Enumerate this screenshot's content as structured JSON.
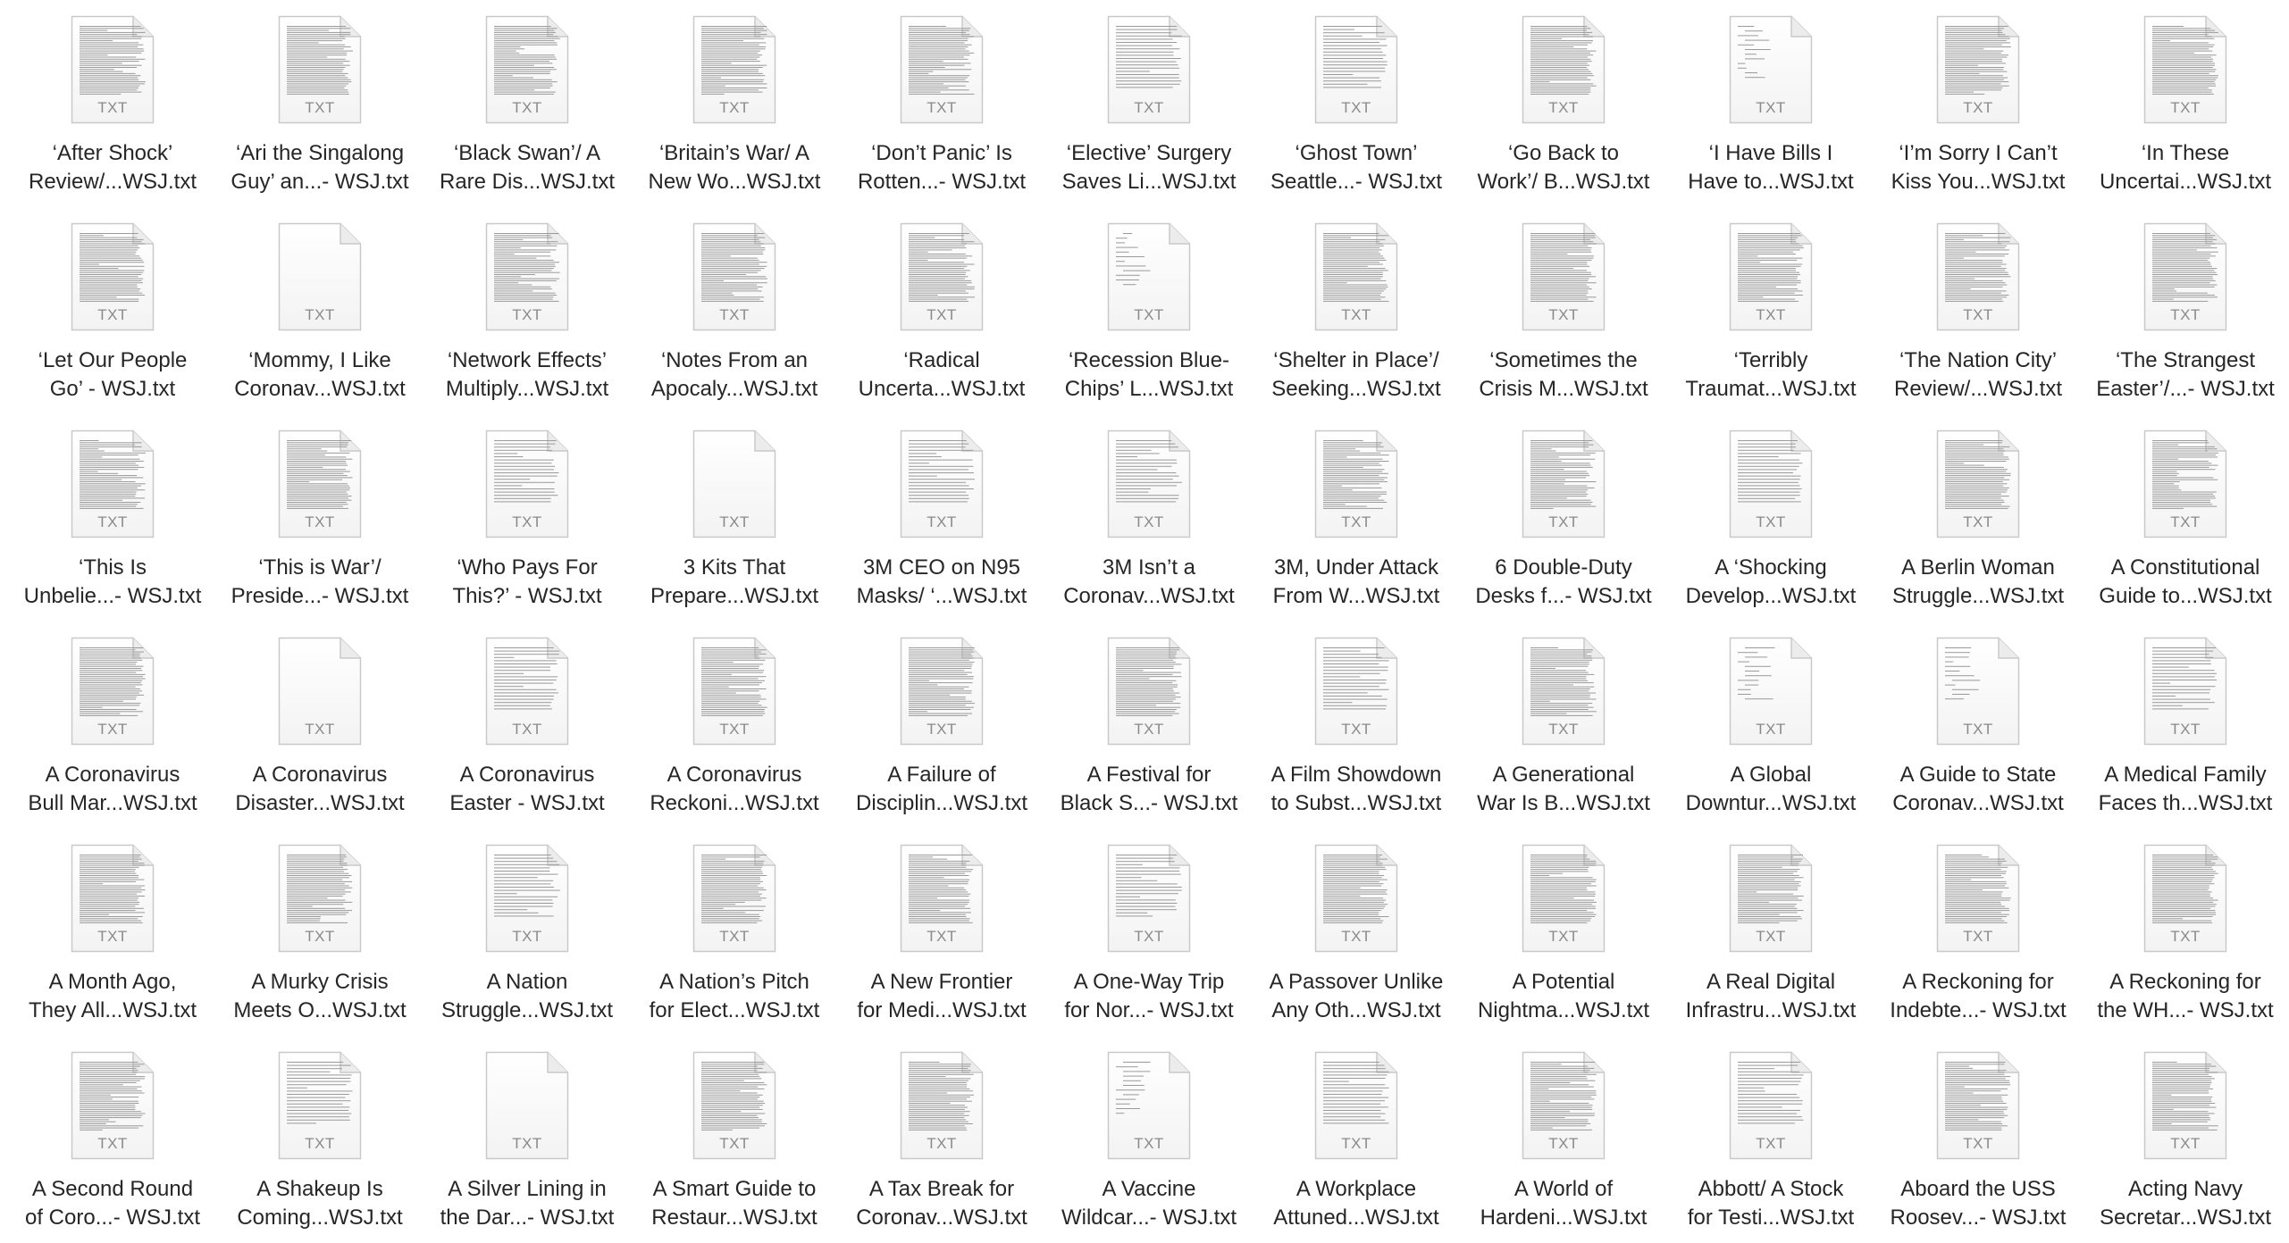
{
  "file_type_label": "TXT",
  "files": [
    {
      "line1": "‘After Shock’",
      "line2": "Review/...WSJ.txt",
      "preview": "dense"
    },
    {
      "line1": "‘Ari the Singalong",
      "line2": "Guy’ an...- WSJ.txt",
      "preview": "dense"
    },
    {
      "line1": "‘Black Swan’/ A",
      "line2": "Rare Dis...WSJ.txt",
      "preview": "dense"
    },
    {
      "line1": "‘Britain’s War/ A",
      "line2": "New Wo...WSJ.txt",
      "preview": "dense"
    },
    {
      "line1": "‘Don’t Panic’ Is",
      "line2": "Rotten...- WSJ.txt",
      "preview": "dense"
    },
    {
      "line1": "‘Elective’ Surgery",
      "line2": "Saves Li...WSJ.txt",
      "preview": "medium"
    },
    {
      "line1": "‘Ghost Town’",
      "line2": "Seattle...- WSJ.txt",
      "preview": "medium"
    },
    {
      "line1": "‘Go Back to",
      "line2": "Work’/ B...WSJ.txt",
      "preview": "dense"
    },
    {
      "line1": "‘I Have Bills I",
      "line2": "Have to...WSJ.txt",
      "preview": "sparse"
    },
    {
      "line1": "‘I’m Sorry I Can’t",
      "line2": "Kiss You...WSJ.txt",
      "preview": "dense"
    },
    {
      "line1": "‘In These",
      "line2": "Uncertai...WSJ.txt",
      "preview": "dense"
    },
    {
      "line1": "‘Let Our People",
      "line2": "Go’ - WSJ.txt",
      "preview": "dense"
    },
    {
      "line1": "‘Mommy, I Like",
      "line2": "Coronav...WSJ.txt",
      "preview": "blank"
    },
    {
      "line1": "‘Network Effects’",
      "line2": "Multiply...WSJ.txt",
      "preview": "dense"
    },
    {
      "line1": "‘Notes From an",
      "line2": "Apocaly...WSJ.txt",
      "preview": "dense"
    },
    {
      "line1": "‘Radical",
      "line2": "Uncerta...WSJ.txt",
      "preview": "dense"
    },
    {
      "line1": "‘Recession Blue-",
      "line2": "Chips’ L...WSJ.txt",
      "preview": "sparse"
    },
    {
      "line1": "‘Shelter in Place’/",
      "line2": "Seeking...WSJ.txt",
      "preview": "dense"
    },
    {
      "line1": "‘Sometimes the",
      "line2": "Crisis M...WSJ.txt",
      "preview": "dense"
    },
    {
      "line1": "‘Terribly",
      "line2": "Traumat...WSJ.txt",
      "preview": "dense"
    },
    {
      "line1": "‘The Nation City’",
      "line2": "Review/...WSJ.txt",
      "preview": "dense"
    },
    {
      "line1": "‘The Strangest",
      "line2": "Easter’/...- WSJ.txt",
      "preview": "dense"
    },
    {
      "line1": "‘This Is",
      "line2": "Unbelie...- WSJ.txt",
      "preview": "dense"
    },
    {
      "line1": "‘This is War’/",
      "line2": "Preside...- WSJ.txt",
      "preview": "dense"
    },
    {
      "line1": "‘Who Pays For",
      "line2": "This?’ - WSJ.txt",
      "preview": "medium"
    },
    {
      "line1": "3 Kits That",
      "line2": "Prepare...WSJ.txt",
      "preview": "blank"
    },
    {
      "line1": "3M CEO on N95",
      "line2": "Masks/ ‘...WSJ.txt",
      "preview": "medium"
    },
    {
      "line1": "3M Isn’t a",
      "line2": "Coronav...WSJ.txt",
      "preview": "medium"
    },
    {
      "line1": "3M, Under Attack",
      "line2": "From W...WSJ.txt",
      "preview": "dense"
    },
    {
      "line1": "6 Double-Duty",
      "line2": "Desks f...- WSJ.txt",
      "preview": "dense"
    },
    {
      "line1": "A ‘Shocking",
      "line2": "Develop...WSJ.txt",
      "preview": "medium"
    },
    {
      "line1": "A Berlin Woman",
      "line2": "Struggle...WSJ.txt",
      "preview": "dense"
    },
    {
      "line1": "A Constitutional",
      "line2": "Guide to...WSJ.txt",
      "preview": "dense"
    },
    {
      "line1": "A Coronavirus",
      "line2": "Bull Mar...WSJ.txt",
      "preview": "dense"
    },
    {
      "line1": "A Coronavirus",
      "line2": "Disaster...WSJ.txt",
      "preview": "blank"
    },
    {
      "line1": "A Coronavirus",
      "line2": "Easter - WSJ.txt",
      "preview": "medium"
    },
    {
      "line1": "A Coronavirus",
      "line2": "Reckoni...WSJ.txt",
      "preview": "dense"
    },
    {
      "line1": "A Failure of",
      "line2": "Disciplin...WSJ.txt",
      "preview": "dense"
    },
    {
      "line1": "A Festival for",
      "line2": "Black S...- WSJ.txt",
      "preview": "dense"
    },
    {
      "line1": "A Film Showdown",
      "line2": "to Subst...WSJ.txt",
      "preview": "medium"
    },
    {
      "line1": "A Generational",
      "line2": "War Is B...WSJ.txt",
      "preview": "dense"
    },
    {
      "line1": "A Global",
      "line2": "Downtur...WSJ.txt",
      "preview": "sparse"
    },
    {
      "line1": "A Guide to State",
      "line2": "Coronav...WSJ.txt",
      "preview": "sparse"
    },
    {
      "line1": "A Medical Family",
      "line2": "Faces th...WSJ.txt",
      "preview": "medium"
    },
    {
      "line1": "A Month Ago,",
      "line2": "They All...WSJ.txt",
      "preview": "dense"
    },
    {
      "line1": "A Murky Crisis",
      "line2": "Meets O...WSJ.txt",
      "preview": "dense"
    },
    {
      "line1": "A Nation",
      "line2": "Struggle...WSJ.txt",
      "preview": "medium"
    },
    {
      "line1": "A Nation’s Pitch",
      "line2": "for Elect...WSJ.txt",
      "preview": "dense"
    },
    {
      "line1": "A New Frontier",
      "line2": "for Medi...WSJ.txt",
      "preview": "dense"
    },
    {
      "line1": "A One-Way Trip",
      "line2": "for Nor...- WSJ.txt",
      "preview": "medium"
    },
    {
      "line1": "A Passover Unlike",
      "line2": "Any Oth...WSJ.txt",
      "preview": "dense"
    },
    {
      "line1": "A Potential",
      "line2": "Nightma...WSJ.txt",
      "preview": "dense"
    },
    {
      "line1": "A Real Digital",
      "line2": "Infrastru...WSJ.txt",
      "preview": "dense"
    },
    {
      "line1": "A Reckoning for",
      "line2": "Indebte...- WSJ.txt",
      "preview": "dense"
    },
    {
      "line1": "A Reckoning for",
      "line2": "the WH...- WSJ.txt",
      "preview": "dense"
    },
    {
      "line1": "A Second Round",
      "line2": "of Coro...- WSJ.txt",
      "preview": "dense"
    },
    {
      "line1": "A Shakeup Is",
      "line2": "Coming...WSJ.txt",
      "preview": "medium"
    },
    {
      "line1": "A Silver Lining in",
      "line2": "the Dar...- WSJ.txt",
      "preview": "blank"
    },
    {
      "line1": "A Smart Guide to",
      "line2": "Restaur...WSJ.txt",
      "preview": "dense"
    },
    {
      "line1": "A Tax Break for",
      "line2": "Coronav...WSJ.txt",
      "preview": "dense"
    },
    {
      "line1": "A Vaccine",
      "line2": "Wildcar...- WSJ.txt",
      "preview": "sparse"
    },
    {
      "line1": "A Workplace",
      "line2": "Attuned...WSJ.txt",
      "preview": "medium"
    },
    {
      "line1": "A World of",
      "line2": "Hardeni...WSJ.txt",
      "preview": "dense"
    },
    {
      "line1": "Abbott/ A Stock",
      "line2": "for Testi...WSJ.txt",
      "preview": "medium"
    },
    {
      "line1": "Aboard the USS",
      "line2": "Roosev...- WSJ.txt",
      "preview": "dense"
    },
    {
      "line1": "Acting Navy",
      "line2": "Secretar...WSJ.txt",
      "preview": "dense"
    }
  ]
}
